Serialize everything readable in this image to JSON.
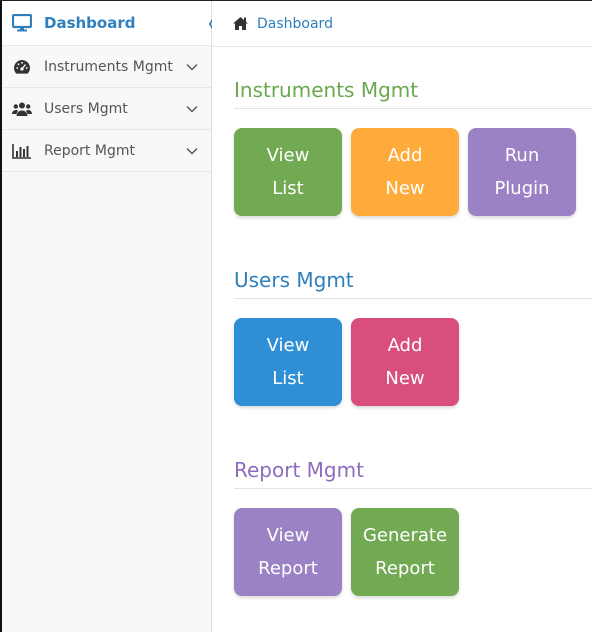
{
  "sidebar": {
    "items": [
      {
        "label": "Dashboard",
        "icon": "monitor-icon"
      },
      {
        "label": "Instruments Mgmt",
        "icon": "dashboard-gauge-icon"
      },
      {
        "label": "Users Mgmt",
        "icon": "users-icon"
      },
      {
        "label": "Report Mgmt",
        "icon": "bar-chart-icon"
      }
    ]
  },
  "breadcrumb": {
    "home_icon": "home-icon",
    "label": "Dashboard"
  },
  "sections": [
    {
      "title": "Instruments Mgmt",
      "title_color": "#6aa84f",
      "tiles": [
        {
          "line1": "View",
          "line2": "List",
          "color": "#72a953"
        },
        {
          "line1": "Add",
          "line2": "New",
          "color": "#ffab3b"
        },
        {
          "line1": "Run",
          "line2": "Plugin",
          "color": "#9b82c4"
        }
      ]
    },
    {
      "title": "Users Mgmt",
      "title_color": "#2f7fbd",
      "tiles": [
        {
          "line1": "View",
          "line2": "List",
          "color": "#2f8fd6"
        },
        {
          "line1": "Add",
          "line2": "New",
          "color": "#d84f7f"
        }
      ]
    },
    {
      "title": "Report Mgmt",
      "title_color": "#8e6bbf",
      "tiles": [
        {
          "line1": "View",
          "line2": "Report",
          "color": "#9b82c4"
        },
        {
          "line1": "Generate",
          "line2": "Report",
          "color": "#72a953"
        }
      ]
    }
  ],
  "colors": {
    "accent": "#2f7fbd"
  }
}
